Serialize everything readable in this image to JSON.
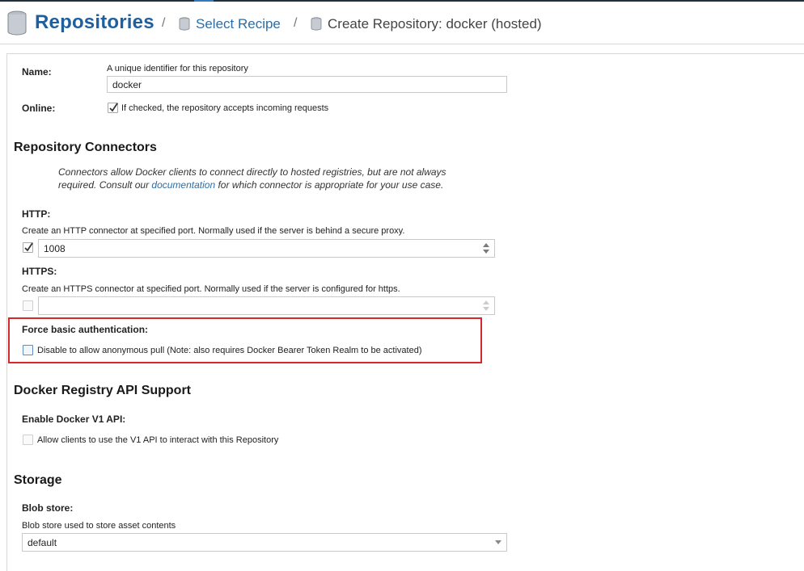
{
  "header": {
    "title": "Repositories",
    "separator": "/",
    "crumb1": "Select Recipe",
    "crumb2": "Create Repository: docker (hosted)"
  },
  "form": {
    "name": {
      "label": "Name:",
      "help": "A unique identifier for this repository",
      "value": "docker"
    },
    "online": {
      "label": "Online:",
      "checkbox_label": "If checked, the repository accepts incoming requests",
      "checked": true
    }
  },
  "connectors": {
    "heading": "Repository Connectors",
    "description_pre": "Connectors allow Docker clients to connect directly to hosted registries, but are not always required. Consult our ",
    "description_link": "documentation",
    "description_post": " for which connector is appropriate for your use case.",
    "http": {
      "label": "HTTP:",
      "help": "Create an HTTP connector at specified port. Normally used if the server is behind a secure proxy.",
      "checked": true,
      "value": "1008"
    },
    "https": {
      "label": "HTTPS:",
      "help": "Create an HTTPS connector at specified port. Normally used if the server is configured for https.",
      "checked": false,
      "value": ""
    },
    "force_auth": {
      "label": "Force basic authentication:",
      "checkbox_label": "Disable to allow anonymous pull (Note: also requires Docker Bearer Token Realm to be activated)",
      "checked": false
    }
  },
  "docker_api": {
    "heading": "Docker Registry API Support",
    "v1": {
      "label": "Enable Docker V1 API:",
      "checkbox_label": "Allow clients to use the V1 API to interact with this Repository",
      "checked": false
    }
  },
  "storage": {
    "heading": "Storage",
    "blob": {
      "label": "Blob store:",
      "help": "Blob store used to store asset contents",
      "value": "default"
    }
  },
  "colors": {
    "accent": "#1f5f9e",
    "link": "#2e6da4",
    "highlight": "#d9262c"
  }
}
